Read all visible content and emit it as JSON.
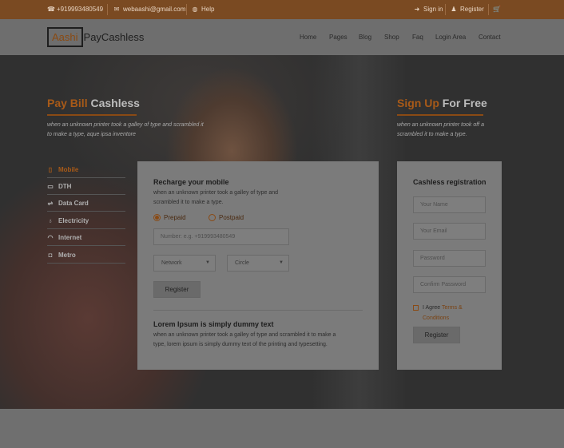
{
  "topbar": {
    "phone": "+919993480549",
    "email": "webaashi@gmail.com",
    "help": "Help",
    "signin": "Sign in",
    "register": "Register"
  },
  "logo": {
    "boxed": "Aashi",
    "rest": "PayCashless"
  },
  "nav": [
    "Home",
    "Pages",
    "Blog",
    "Shop",
    "Faq",
    "Login Area",
    "Contact"
  ],
  "hero_left": {
    "title_accent": "Pay Bill",
    "title_rest": "Cashless",
    "desc_line1": "when an unknown printer took a galley of type and scrambled it",
    "desc_line2": "to make a type, aque ipsa inventore"
  },
  "hero_right": {
    "title_accent": "Sign Up",
    "title_rest": "For Free",
    "desc_line1": "when an unknown printer took off a",
    "desc_line2": "scrambled it to make a type."
  },
  "services": [
    {
      "label": "Mobile",
      "icon": "mobile-icon",
      "active": true
    },
    {
      "label": "DTH",
      "icon": "tv-icon",
      "active": false
    },
    {
      "label": "Data Card",
      "icon": "usb-icon",
      "active": false
    },
    {
      "label": "Electricity",
      "icon": "bulb-icon",
      "active": false
    },
    {
      "label": "Internet",
      "icon": "wifi-icon",
      "active": false
    },
    {
      "label": "Metro",
      "icon": "train-icon",
      "active": false
    }
  ],
  "recharge": {
    "title": "Recharge your mobile",
    "desc_line1": "when an unknown printer took a galley of type and",
    "desc_line2": "scrambled it to make a type.",
    "prepaid": "Prepaid",
    "postpaid": "Postpaid",
    "number_placeholder": "Number: e.g. +919993480549",
    "network": "Network",
    "circle": "Circle",
    "register": "Register",
    "lorem_title": "Lorem Ipsum is simply dummy text",
    "lorem_line1": "when an unknown printer took a galley of type and scrambled it to make a",
    "lorem_line2": "type, lorem ipsum is simply dummy text of the printing and typesetting."
  },
  "registration": {
    "title": "Cashless registration",
    "name_placeholder": "Your Name",
    "email_placeholder": "Your Email",
    "password_placeholder": "Password",
    "confirm_placeholder": "Confirm Password",
    "agree": "I Agree",
    "terms_1": "Terms &",
    "terms_2": "Conditions",
    "register": "Register"
  },
  "colors": {
    "accent": "#a85a18",
    "topbar": "#7a4a22"
  }
}
